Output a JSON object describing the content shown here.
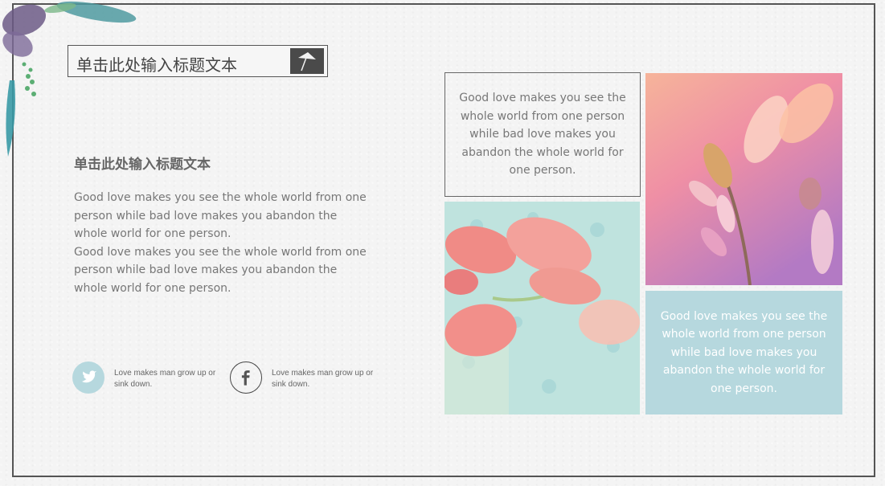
{
  "slide": {
    "title_box_text": "单击此处输入标题文本",
    "subtitle": "单击此处输入标题文本",
    "paragraph_1": "Good love makes you see the whole world from one person while bad love makes you abandon the whole world for one person.",
    "paragraph_2": "Good love makes you see the whole world from one person while bad love makes you abandon the whole world for one person."
  },
  "social": [
    {
      "icon": "twitter-icon",
      "caption": "Love makes man grow up or sink down."
    },
    {
      "icon": "facebook-icon",
      "caption": "Love makes man grow up or sink down."
    }
  ],
  "cards": {
    "top_left": "Good love makes you see the whole world from one person while bad love makes you abandon the whole world for one person.",
    "bottom_right": "Good love makes you see the whole world from one person while bad love makes you abandon the whole world for one person."
  },
  "colors": {
    "accent_blue": "#b6d8de",
    "text_gray": "#777777"
  }
}
